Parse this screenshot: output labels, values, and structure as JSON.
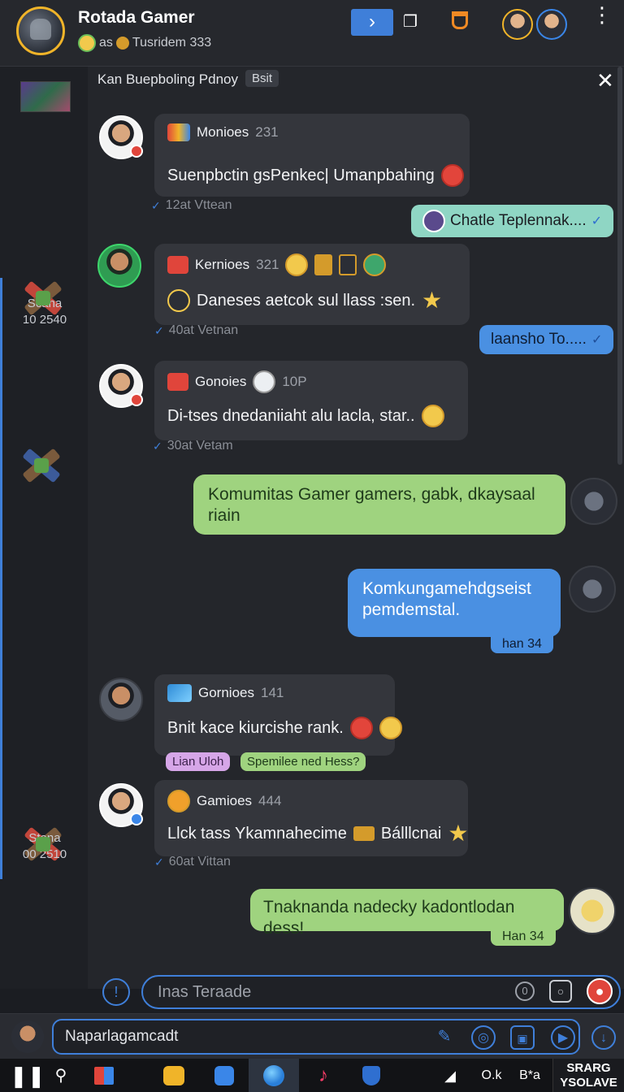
{
  "header": {
    "title": "Rotada Gamer",
    "subtitle_prefix": "as",
    "subtitle": "Tusridem 333"
  },
  "rail": {
    "entries": [
      {
        "name": "Scana",
        "value": "10 2540"
      },
      {
        "name": "Stana",
        "value": "00 2510"
      }
    ]
  },
  "pinned": {
    "title": "Kan Buepboling Pdnoy",
    "badge": "Bsit"
  },
  "messages": [
    {
      "sender": "Monioes",
      "count": "231",
      "text": "Suenpbctin gsPenkec| Umanpbahing",
      "time": "12at Vttean"
    },
    {
      "sender": "Kernioes",
      "count": "321",
      "text": "Daneses aetcok sul llass :sen.",
      "time": "40at Vetnan"
    },
    {
      "sender": "Gonoies",
      "count": "10P",
      "text": "Di-tses dnedaniiaht alu lacla, star..",
      "time": "30at Vetam"
    },
    {
      "sender": "Gornioes",
      "count": "141",
      "text": "Bnit kace kiurcishe rank.",
      "time": ""
    },
    {
      "sender": "Gamioes",
      "count": "444",
      "text": "Llck tass Ykamnahecime",
      "text2": "Bálllcnai",
      "time": "60at Vittan"
    }
  ],
  "outgoing": {
    "reply1": "Chatle Teplennak....",
    "reply2": "laansho To.....",
    "green1": "Komumitas Gamer gamers, gabk, dkaysaal riain",
    "blue1": "Komkungamehdgseist pemdemstal.",
    "blue1_time": "han 34",
    "green2": "Tnaknanda nadecky kadontlodan dess!",
    "green2_time": "Han 34"
  },
  "tags": {
    "pink": "Lian Uloh",
    "green": "Spemilee ned Hess?"
  },
  "chat_input": {
    "placeholder": "Inas Teraade"
  },
  "compose": {
    "value": "Naparlagamcadt"
  },
  "taskbar": {
    "tray_text1": "O.k",
    "tray_text2": "B*a",
    "clock_line1": "SRARG",
    "clock_line2": "YSOLAVE"
  },
  "colors": {
    "accent": "#3f7fd9",
    "bubble": "#34363c",
    "outgoing_green": "#9fd37f",
    "outgoing_teal": "#8fd6c4",
    "outgoing_blue": "#4a90e2",
    "background": "#24262b"
  }
}
